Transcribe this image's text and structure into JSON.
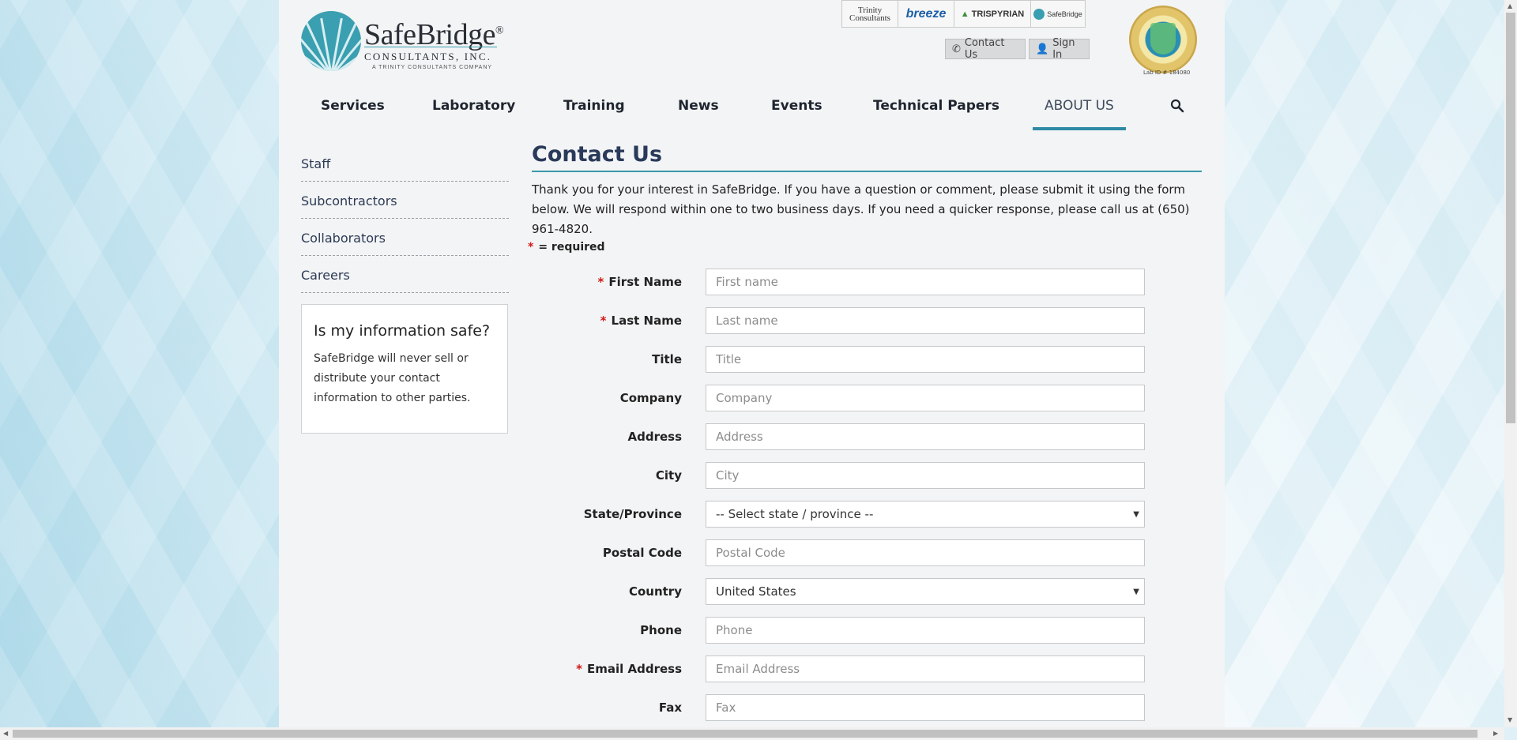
{
  "brand": {
    "name": "SafeBridge",
    "registered": "®",
    "subtitle": "CONSULTANTS, INC.",
    "tagline": "A TRINITY CONSULTANTS COMPANY"
  },
  "partners": {
    "trinity": "Trinity Consultants",
    "breeze": "breeze",
    "trispyrian": "TRISPYRIAN",
    "safebridge": "SafeBridge"
  },
  "utility": {
    "contact_label": "Contact Us",
    "signin_label": "Sign In"
  },
  "seal": {
    "caption": "Lab ID # 184080"
  },
  "nav": {
    "items": [
      "Services",
      "Laboratory",
      "Training",
      "News",
      "Events",
      "Technical Papers",
      "ABOUT US"
    ],
    "active": "ABOUT US"
  },
  "sidebar": {
    "links": [
      "Staff",
      "Subcontractors",
      "Collaborators",
      "Careers"
    ],
    "info_title": "Is my information safe?",
    "info_body": "SafeBridge will never sell or distribute your contact information to other parties."
  },
  "main": {
    "title": "Contact Us",
    "intro": "Thank you for your interest in SafeBridge. If you have a question or comment, please submit it using the form below. We will respond within one to two business days. If you need a quicker response, please call us at (650) 961-4820.",
    "required_star": "*",
    "required_note": "= required"
  },
  "form": {
    "first_name": {
      "label": "First Name",
      "placeholder": "First name",
      "required": true
    },
    "last_name": {
      "label": "Last Name",
      "placeholder": "Last name",
      "required": true
    },
    "title": {
      "label": "Title",
      "placeholder": "Title"
    },
    "company": {
      "label": "Company",
      "placeholder": "Company"
    },
    "address": {
      "label": "Address",
      "placeholder": "Address"
    },
    "city": {
      "label": "City",
      "placeholder": "City"
    },
    "state": {
      "label": "State/Province",
      "value": "-- Select state / province --"
    },
    "postal": {
      "label": "Postal Code",
      "placeholder": "Postal Code"
    },
    "country": {
      "label": "Country",
      "value": "United States"
    },
    "phone": {
      "label": "Phone",
      "placeholder": "Phone"
    },
    "email": {
      "label": "Email Address",
      "placeholder": "Email Address",
      "required": true
    },
    "fax": {
      "label": "Fax",
      "placeholder": "Fax"
    }
  },
  "colors": {
    "accent": "#2f8aa5",
    "required": "#d01818",
    "heading": "#2a3a5a"
  }
}
